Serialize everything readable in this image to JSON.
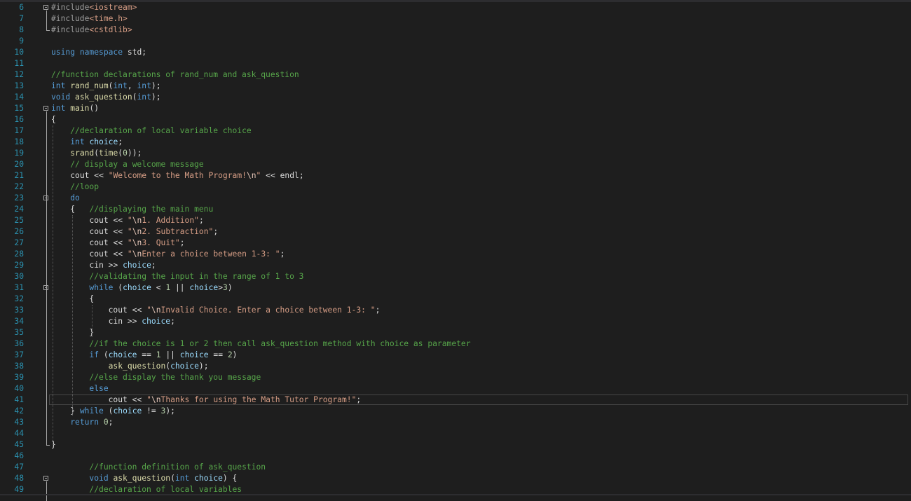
{
  "editor": {
    "lines": [
      {
        "n": "6",
        "code": "#include<iostream>"
      },
      {
        "n": "7",
        "code": "#include<time.h>"
      },
      {
        "n": "8",
        "code": "#include<cstdlib>"
      },
      {
        "n": "9",
        "code": ""
      },
      {
        "n": "10",
        "code": "using namespace std;"
      },
      {
        "n": "11",
        "code": ""
      },
      {
        "n": "12",
        "code": "//function declarations of rand_num and ask_question"
      },
      {
        "n": "13",
        "code": "int rand_num(int, int);"
      },
      {
        "n": "14",
        "code": "void ask_question(int);"
      },
      {
        "n": "15",
        "code": "int main()"
      },
      {
        "n": "16",
        "code": "{"
      },
      {
        "n": "17",
        "code": "    //declaration of local variable choice"
      },
      {
        "n": "18",
        "code": "    int choice;"
      },
      {
        "n": "19",
        "code": "    srand(time(0));"
      },
      {
        "n": "20",
        "code": "    // display a welcome message"
      },
      {
        "n": "21",
        "code": "    cout << \"Welcome to the Math Program!\\n\" << endl;"
      },
      {
        "n": "22",
        "code": "    //loop"
      },
      {
        "n": "23",
        "code": "    do"
      },
      {
        "n": "24",
        "code": "    {   //displaying the main menu"
      },
      {
        "n": "25",
        "code": "        cout << \"\\n1. Addition\";"
      },
      {
        "n": "26",
        "code": "        cout << \"\\n2. Subtraction\";"
      },
      {
        "n": "27",
        "code": "        cout << \"\\n3. Quit\";"
      },
      {
        "n": "28",
        "code": "        cout << \"\\nEnter a choice between 1-3: \";"
      },
      {
        "n": "29",
        "code": "        cin >> choice;"
      },
      {
        "n": "30",
        "code": "        //validating the input in the range of 1 to 3"
      },
      {
        "n": "31",
        "code": "        while (choice < 1 || choice>3)"
      },
      {
        "n": "32",
        "code": "        {"
      },
      {
        "n": "33",
        "code": "            cout << \"\\nInvalid Choice. Enter a choice between 1-3: \";"
      },
      {
        "n": "34",
        "code": "            cin >> choice;"
      },
      {
        "n": "35",
        "code": "        }"
      },
      {
        "n": "36",
        "code": "        //if the choice is 1 or 2 then call ask_question method with choice as parameter"
      },
      {
        "n": "37",
        "code": "        if (choice == 1 || choice == 2)"
      },
      {
        "n": "38",
        "code": "            ask_question(choice);"
      },
      {
        "n": "39",
        "code": "        //else display the thank you message"
      },
      {
        "n": "40",
        "code": "        else"
      },
      {
        "n": "41",
        "code": "            cout << \"\\nThanks for using the Math Tutor Program!\";"
      },
      {
        "n": "42",
        "code": "    } while (choice != 3);"
      },
      {
        "n": "43",
        "code": "    return 0;"
      },
      {
        "n": "44",
        "code": ""
      },
      {
        "n": "45",
        "code": "}"
      },
      {
        "n": "46",
        "code": ""
      },
      {
        "n": "47",
        "code": "        //function definition of ask_question"
      },
      {
        "n": "48",
        "code": "        void ask_question(int choice) {"
      },
      {
        "n": "49",
        "code": "        //declaration of local variables"
      }
    ],
    "folds_at": [
      "6",
      "15",
      "23",
      "31",
      "48"
    ],
    "current_line": "41"
  },
  "colors": {
    "background": "#1e1e1e",
    "line_number": "#2b91af",
    "keyword": "#569cd6",
    "comment": "#57a64a",
    "string": "#d69d85",
    "variable": "#9cdcfe",
    "function": "#dcdcaa",
    "number": "#b5cea8"
  }
}
